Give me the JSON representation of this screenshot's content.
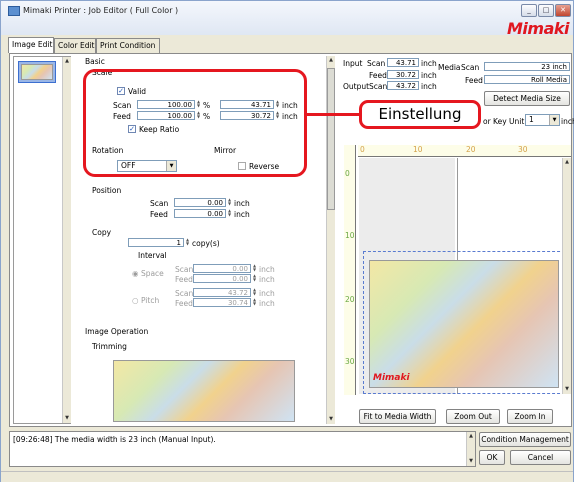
{
  "window": {
    "title": "Mimaki Printer : Job Editor ( Full Color )",
    "brand": "Mimaki"
  },
  "tabs": [
    {
      "label": "Image Edit"
    },
    {
      "label": "Color Edit"
    },
    {
      "label": "Print Condition"
    }
  ],
  "basic": {
    "section": "Basic",
    "scale": {
      "label": "Scale",
      "valid_label": "Valid",
      "valid_checked": true,
      "scan_label": "Scan",
      "scan_percent": "100.00",
      "scan_inch": "43.71",
      "feed_label": "Feed",
      "feed_percent": "100.00",
      "feed_inch": "30.72",
      "percent_unit": "%",
      "inch_unit": "inch",
      "keep_ratio_label": "Keep Ratio",
      "keep_ratio_checked": true
    },
    "rotation": {
      "label": "Rotation",
      "value": "OFF"
    },
    "mirror": {
      "label": "Mirror",
      "reverse_label": "Reverse",
      "reverse_checked": false
    }
  },
  "position": {
    "label": "Position",
    "scan_label": "Scan",
    "scan_value": "0.00",
    "feed_label": "Feed",
    "feed_value": "0.00",
    "unit": "inch"
  },
  "copy": {
    "label": "Copy",
    "count": "1",
    "count_unit": "copy(s)",
    "interval_label": "Interval",
    "space_label": "Space",
    "space_scan_label": "Scan",
    "space_scan": "0.00",
    "space_feed_label": "Feed",
    "space_feed": "0.00",
    "pitch_label": "Pitch",
    "pitch_scan_label": "Scan",
    "pitch_scan": "43.72",
    "pitch_feed_label": "Feed",
    "pitch_feed": "30.74",
    "unit": "inch"
  },
  "image_operation": {
    "label": "Image Operation",
    "trimming_label": "Trimming"
  },
  "info": {
    "input_label": "Input",
    "output_label": "Output",
    "scan_label": "Scan",
    "feed_label": "Feed",
    "input_scan": "43.71",
    "input_feed": "30.72",
    "output_scan": "43.72",
    "unit": "inch",
    "media_label": "Media",
    "media_scan": "23 inch",
    "media_feed": "Roll Media",
    "detect_button": "Detect Media Size",
    "key_unit_label": "or Key Unit",
    "key_unit_value": "1",
    "key_unit_suffix": "inch"
  },
  "callout": {
    "text": "Einstellung"
  },
  "ruler": {
    "top_ticks": [
      "0",
      "10",
      "20",
      "30"
    ],
    "side_ticks": [
      "0",
      "10",
      "20",
      "30"
    ]
  },
  "map_label": "Mimaki",
  "view_buttons": {
    "fit": "Fit to Media Width",
    "zoom_out": "Zoom Out",
    "zoom_in": "Zoom In"
  },
  "log": {
    "message": "[09:26:48] The media width is 23 inch (Manual Input)."
  },
  "bottom_buttons": {
    "condition": "Condition Management",
    "ok": "OK",
    "cancel": "Cancel"
  },
  "colors": {
    "accent_red": "#e5171f",
    "selection_blue": "#3c6fd0"
  }
}
